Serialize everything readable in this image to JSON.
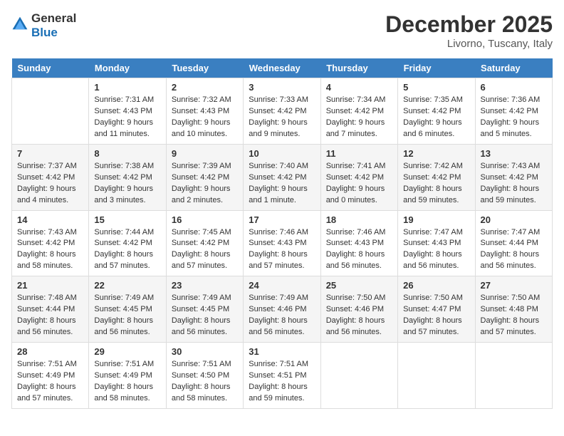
{
  "header": {
    "logo_general": "General",
    "logo_blue": "Blue",
    "month": "December 2025",
    "location": "Livorno, Tuscany, Italy"
  },
  "weekdays": [
    "Sunday",
    "Monday",
    "Tuesday",
    "Wednesday",
    "Thursday",
    "Friday",
    "Saturday"
  ],
  "weeks": [
    [
      {
        "day": "",
        "sunrise": "",
        "sunset": "",
        "daylight": ""
      },
      {
        "day": "1",
        "sunrise": "Sunrise: 7:31 AM",
        "sunset": "Sunset: 4:43 PM",
        "daylight": "Daylight: 9 hours and 11 minutes."
      },
      {
        "day": "2",
        "sunrise": "Sunrise: 7:32 AM",
        "sunset": "Sunset: 4:43 PM",
        "daylight": "Daylight: 9 hours and 10 minutes."
      },
      {
        "day": "3",
        "sunrise": "Sunrise: 7:33 AM",
        "sunset": "Sunset: 4:42 PM",
        "daylight": "Daylight: 9 hours and 9 minutes."
      },
      {
        "day": "4",
        "sunrise": "Sunrise: 7:34 AM",
        "sunset": "Sunset: 4:42 PM",
        "daylight": "Daylight: 9 hours and 7 minutes."
      },
      {
        "day": "5",
        "sunrise": "Sunrise: 7:35 AM",
        "sunset": "Sunset: 4:42 PM",
        "daylight": "Daylight: 9 hours and 6 minutes."
      },
      {
        "day": "6",
        "sunrise": "Sunrise: 7:36 AM",
        "sunset": "Sunset: 4:42 PM",
        "daylight": "Daylight: 9 hours and 5 minutes."
      }
    ],
    [
      {
        "day": "7",
        "sunrise": "Sunrise: 7:37 AM",
        "sunset": "Sunset: 4:42 PM",
        "daylight": "Daylight: 9 hours and 4 minutes."
      },
      {
        "day": "8",
        "sunrise": "Sunrise: 7:38 AM",
        "sunset": "Sunset: 4:42 PM",
        "daylight": "Daylight: 9 hours and 3 minutes."
      },
      {
        "day": "9",
        "sunrise": "Sunrise: 7:39 AM",
        "sunset": "Sunset: 4:42 PM",
        "daylight": "Daylight: 9 hours and 2 minutes."
      },
      {
        "day": "10",
        "sunrise": "Sunrise: 7:40 AM",
        "sunset": "Sunset: 4:42 PM",
        "daylight": "Daylight: 9 hours and 1 minute."
      },
      {
        "day": "11",
        "sunrise": "Sunrise: 7:41 AM",
        "sunset": "Sunset: 4:42 PM",
        "daylight": "Daylight: 9 hours and 0 minutes."
      },
      {
        "day": "12",
        "sunrise": "Sunrise: 7:42 AM",
        "sunset": "Sunset: 4:42 PM",
        "daylight": "Daylight: 8 hours and 59 minutes."
      },
      {
        "day": "13",
        "sunrise": "Sunrise: 7:43 AM",
        "sunset": "Sunset: 4:42 PM",
        "daylight": "Daylight: 8 hours and 59 minutes."
      }
    ],
    [
      {
        "day": "14",
        "sunrise": "Sunrise: 7:43 AM",
        "sunset": "Sunset: 4:42 PM",
        "daylight": "Daylight: 8 hours and 58 minutes."
      },
      {
        "day": "15",
        "sunrise": "Sunrise: 7:44 AM",
        "sunset": "Sunset: 4:42 PM",
        "daylight": "Daylight: 8 hours and 57 minutes."
      },
      {
        "day": "16",
        "sunrise": "Sunrise: 7:45 AM",
        "sunset": "Sunset: 4:42 PM",
        "daylight": "Daylight: 8 hours and 57 minutes."
      },
      {
        "day": "17",
        "sunrise": "Sunrise: 7:46 AM",
        "sunset": "Sunset: 4:43 PM",
        "daylight": "Daylight: 8 hours and 57 minutes."
      },
      {
        "day": "18",
        "sunrise": "Sunrise: 7:46 AM",
        "sunset": "Sunset: 4:43 PM",
        "daylight": "Daylight: 8 hours and 56 minutes."
      },
      {
        "day": "19",
        "sunrise": "Sunrise: 7:47 AM",
        "sunset": "Sunset: 4:43 PM",
        "daylight": "Daylight: 8 hours and 56 minutes."
      },
      {
        "day": "20",
        "sunrise": "Sunrise: 7:47 AM",
        "sunset": "Sunset: 4:44 PM",
        "daylight": "Daylight: 8 hours and 56 minutes."
      }
    ],
    [
      {
        "day": "21",
        "sunrise": "Sunrise: 7:48 AM",
        "sunset": "Sunset: 4:44 PM",
        "daylight": "Daylight: 8 hours and 56 minutes."
      },
      {
        "day": "22",
        "sunrise": "Sunrise: 7:49 AM",
        "sunset": "Sunset: 4:45 PM",
        "daylight": "Daylight: 8 hours and 56 minutes."
      },
      {
        "day": "23",
        "sunrise": "Sunrise: 7:49 AM",
        "sunset": "Sunset: 4:45 PM",
        "daylight": "Daylight: 8 hours and 56 minutes."
      },
      {
        "day": "24",
        "sunrise": "Sunrise: 7:49 AM",
        "sunset": "Sunset: 4:46 PM",
        "daylight": "Daylight: 8 hours and 56 minutes."
      },
      {
        "day": "25",
        "sunrise": "Sunrise: 7:50 AM",
        "sunset": "Sunset: 4:46 PM",
        "daylight": "Daylight: 8 hours and 56 minutes."
      },
      {
        "day": "26",
        "sunrise": "Sunrise: 7:50 AM",
        "sunset": "Sunset: 4:47 PM",
        "daylight": "Daylight: 8 hours and 57 minutes."
      },
      {
        "day": "27",
        "sunrise": "Sunrise: 7:50 AM",
        "sunset": "Sunset: 4:48 PM",
        "daylight": "Daylight: 8 hours and 57 minutes."
      }
    ],
    [
      {
        "day": "28",
        "sunrise": "Sunrise: 7:51 AM",
        "sunset": "Sunset: 4:49 PM",
        "daylight": "Daylight: 8 hours and 57 minutes."
      },
      {
        "day": "29",
        "sunrise": "Sunrise: 7:51 AM",
        "sunset": "Sunset: 4:49 PM",
        "daylight": "Daylight: 8 hours and 58 minutes."
      },
      {
        "day": "30",
        "sunrise": "Sunrise: 7:51 AM",
        "sunset": "Sunset: 4:50 PM",
        "daylight": "Daylight: 8 hours and 58 minutes."
      },
      {
        "day": "31",
        "sunrise": "Sunrise: 7:51 AM",
        "sunset": "Sunset: 4:51 PM",
        "daylight": "Daylight: 8 hours and 59 minutes."
      },
      {
        "day": "",
        "sunrise": "",
        "sunset": "",
        "daylight": ""
      },
      {
        "day": "",
        "sunrise": "",
        "sunset": "",
        "daylight": ""
      },
      {
        "day": "",
        "sunrise": "",
        "sunset": "",
        "daylight": ""
      }
    ]
  ]
}
